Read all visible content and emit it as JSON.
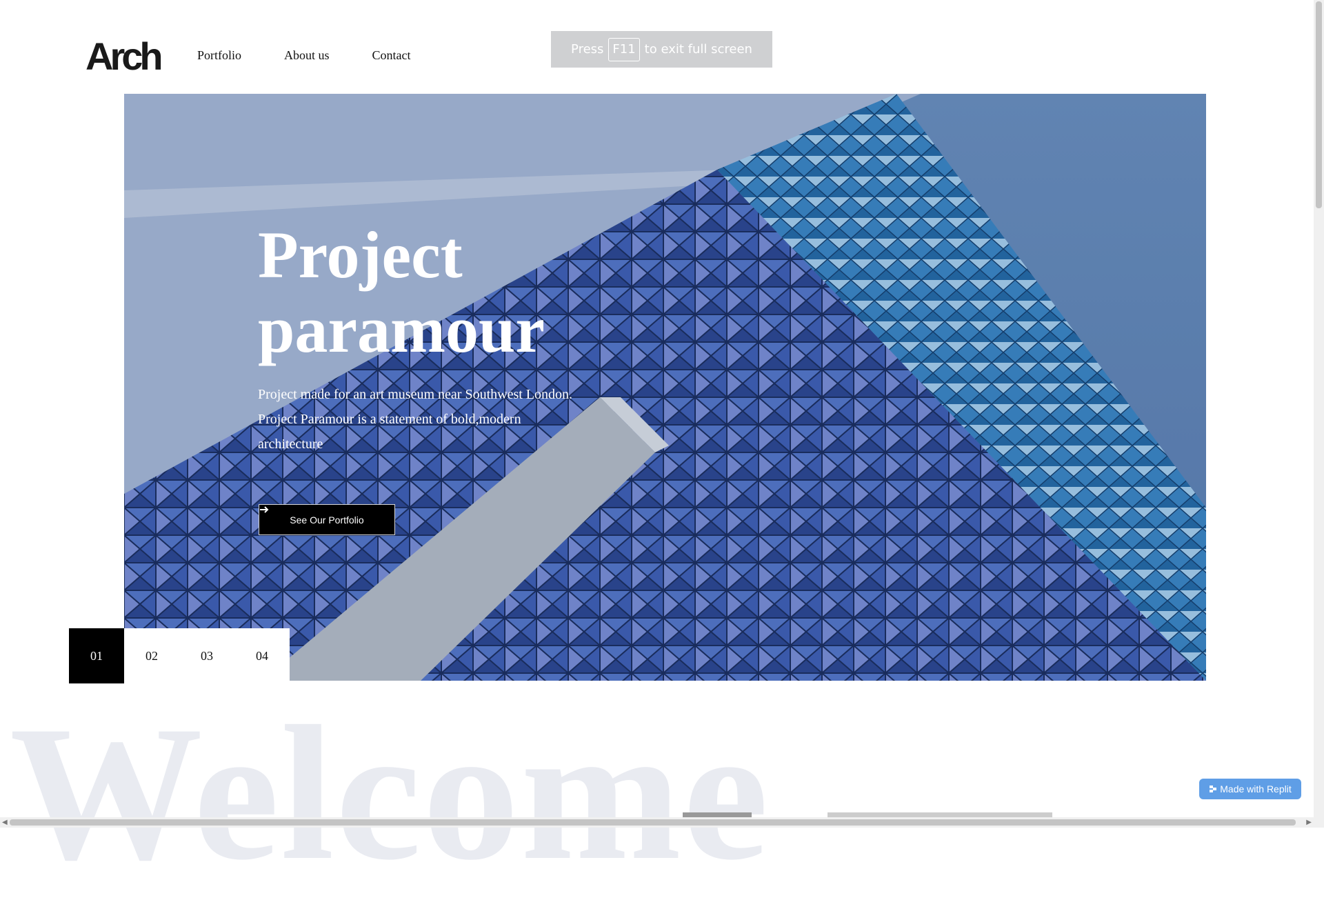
{
  "brand": {
    "logo": "Arch"
  },
  "nav": {
    "items": [
      "Portfolio",
      "About us",
      "Contact"
    ]
  },
  "fullscreen_banner": {
    "press": "Press",
    "key": "F11",
    "rest": "to exit full screen"
  },
  "hero": {
    "title_line1": "Project",
    "title_line2": "paramour",
    "desc_line1": "Project made for an art museum near Southwest London.",
    "desc_line2": "Project Paramour is a statement of bold,modern",
    "desc_line3": "architecture",
    "button_label": "See Our Portfolio",
    "button_icon": "arrow-right-icon"
  },
  "slider": {
    "items": [
      "01",
      "02",
      "03",
      "04"
    ],
    "active_index": 0
  },
  "welcome": {
    "text": "Welcome"
  },
  "replit": {
    "label": "Made with Replit",
    "icon": "replit-icon"
  },
  "colors": {
    "accent": "#000000",
    "hero_blue": "#3c5e9f",
    "welcome_text": "#e9ebf1",
    "badge": "#5f9ee6"
  }
}
